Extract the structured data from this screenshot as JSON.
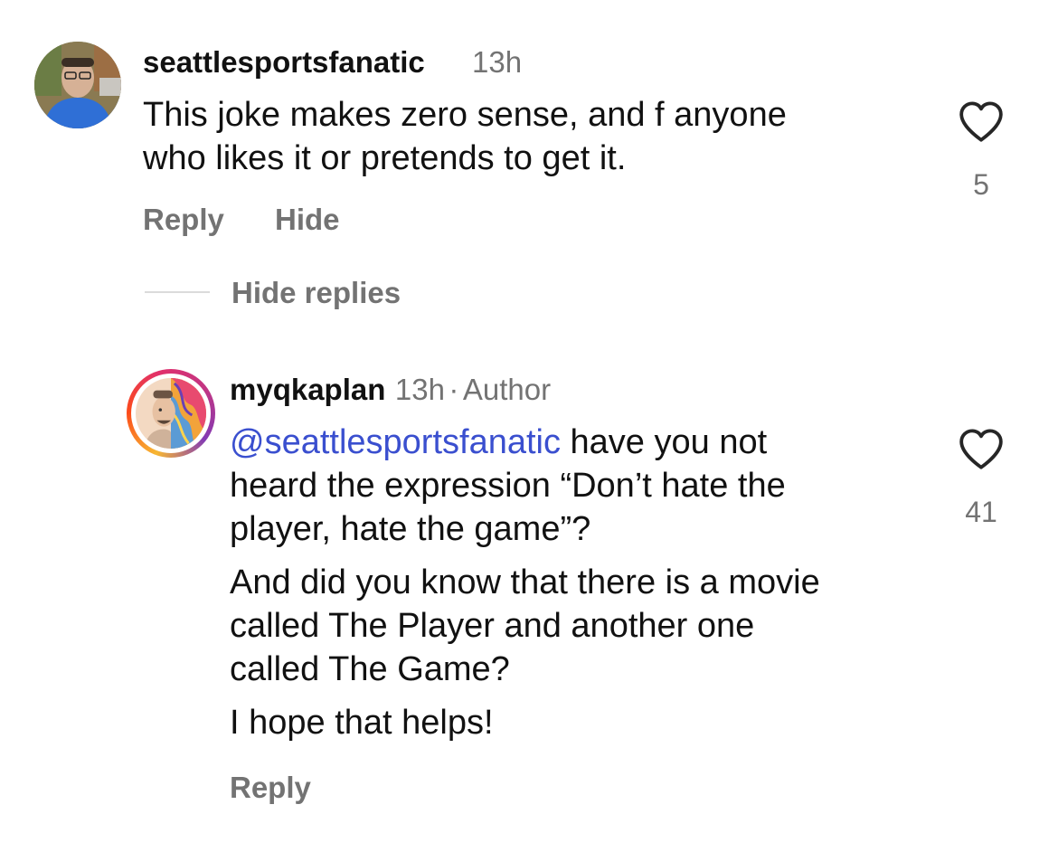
{
  "comment": {
    "username": "seattlesportsfanatic",
    "time": "13h",
    "text_line1": "This joke makes zero sense, and f anyone",
    "text_line2": "who likes it or pretends to get it.",
    "like_count": "5",
    "reply_label": "Reply",
    "hide_label": "Hide"
  },
  "hide_replies_label": "Hide replies",
  "reply": {
    "username": "myqkaplan",
    "time": "13h",
    "separator": "·",
    "author_badge": "Author",
    "mention": "@seattlesportsfanatic",
    "p1_line1_rest": " have you not",
    "p1_line2": "heard the expression “Don’t hate the",
    "p1_line3": "player, hate the game”?",
    "p2_line1": "And did you know that there is a movie",
    "p2_line2": "called The Player and another one",
    "p2_line3": "called The Game?",
    "p3_line1": "I hope that helps!",
    "like_count": "41",
    "reply_label": "Reply"
  },
  "icons": {
    "like": "heart-outline-icon"
  }
}
